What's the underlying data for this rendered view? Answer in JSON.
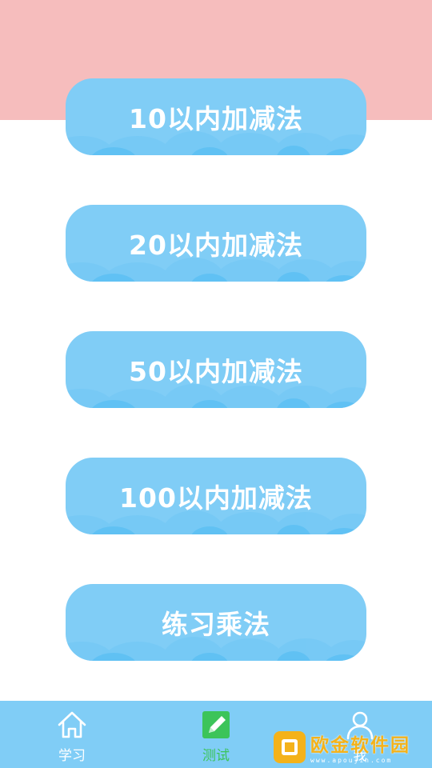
{
  "menu": {
    "items": [
      {
        "label": "10以内加减法"
      },
      {
        "label": "20以内加减法"
      },
      {
        "label": "50以内加减法"
      },
      {
        "label": "100以内加减法"
      },
      {
        "label": "练习乘法"
      }
    ]
  },
  "tabbar": {
    "tabs": [
      {
        "label": "学习",
        "icon": "home-icon",
        "active": false
      },
      {
        "label": "测试",
        "icon": "pencil-icon",
        "active": true
      },
      {
        "label": "我",
        "icon": "person-icon",
        "active": false
      }
    ]
  },
  "watermark": {
    "text": "欧金软件园",
    "url": "www.apoujin.com"
  },
  "colors": {
    "top_band": "#f6bdbd",
    "button": "#80cdf6",
    "tabbar": "#80cdf6",
    "active_tab": "#3cc45a",
    "watermark": "#f4b21a"
  }
}
